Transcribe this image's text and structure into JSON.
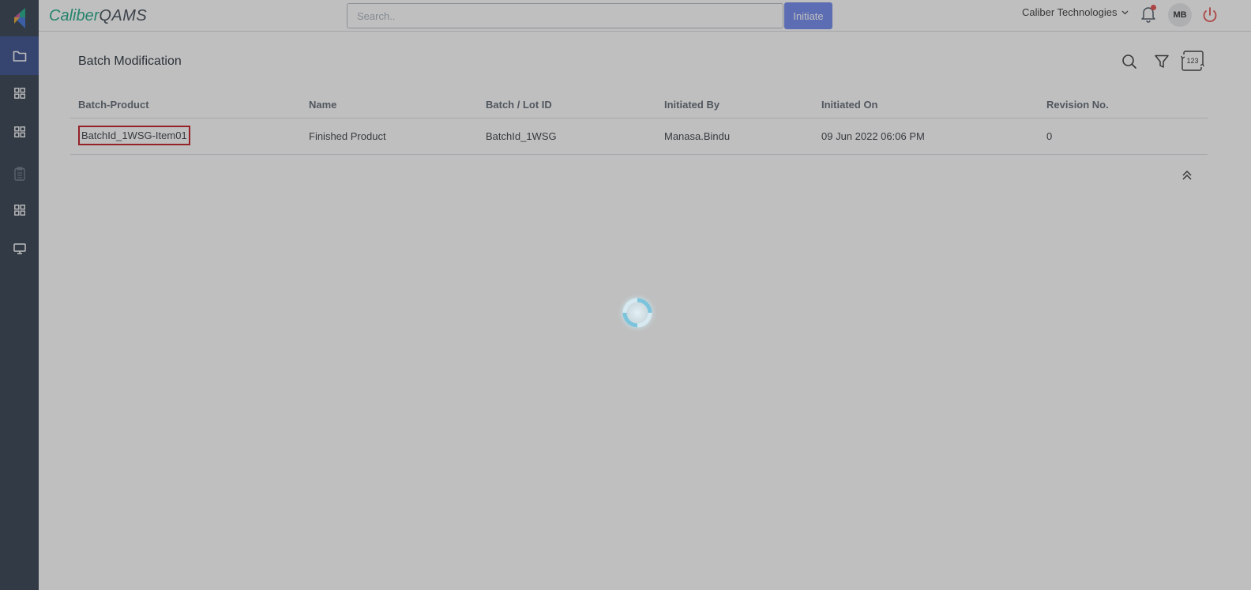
{
  "header": {
    "brand_part1": "Caliber",
    "brand_part2": "QAMS",
    "search_placeholder": "Search..",
    "initiate_label": "Initiate",
    "company": "Caliber Technologies",
    "avatar_initials": "MB"
  },
  "sidebar": {
    "items": [
      {
        "icon": "folder-icon",
        "active": true
      },
      {
        "icon": "grid-icon",
        "active": false
      },
      {
        "icon": "grid-icon",
        "active": false
      },
      {
        "icon": "clipboard-icon",
        "active": false
      },
      {
        "icon": "grid-icon",
        "active": false
      },
      {
        "icon": "monitor-icon",
        "active": false
      }
    ]
  },
  "page": {
    "title": "Batch Modification"
  },
  "table": {
    "columns": [
      "Batch-Product",
      "Name",
      "Batch / Lot ID",
      "Initiated By",
      "Initiated On",
      "Revision No."
    ],
    "rows": [
      [
        "BatchId_1WSG-Item01",
        "Finished Product",
        "BatchId_1WSG",
        "Manasa.Bindu",
        "09 Jun 2022 06:06 PM",
        "0"
      ]
    ]
  },
  "toolbar": {
    "icons": [
      "search-icon",
      "filter-icon",
      "number-toggle-icon"
    ],
    "number_icon_text": "123"
  },
  "colors": {
    "sidebar_bg": "#2c3a49",
    "sidebar_active": "#33488a",
    "brand_green": "#1aa784",
    "initiate_button": "#6e85ee",
    "highlight_border": "#c0151b",
    "notification_dot": "#e54848",
    "power_icon": "#e54848"
  }
}
